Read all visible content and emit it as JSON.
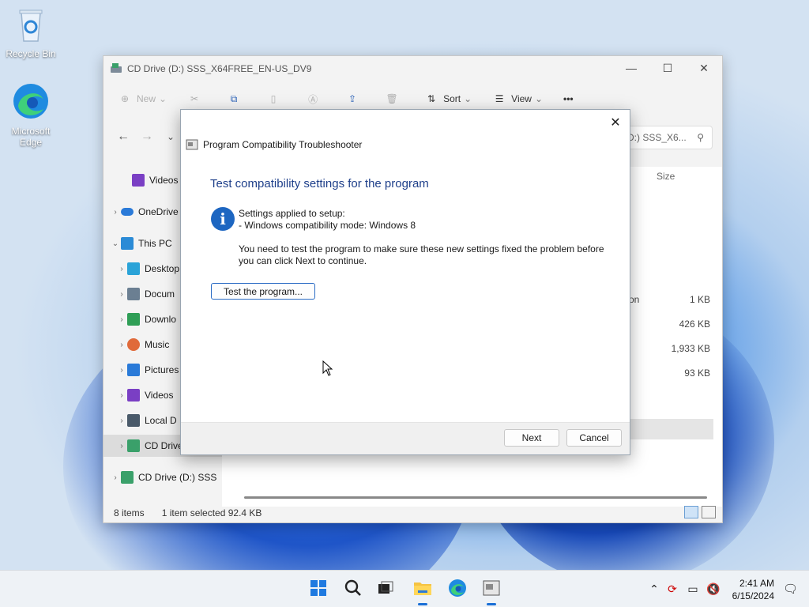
{
  "desktop": {
    "icons": [
      {
        "label": "Recycle Bin",
        "icon": "recycle-bin-icon"
      },
      {
        "label": "Microsoft Edge",
        "icon": "edge-icon"
      }
    ]
  },
  "explorer": {
    "title": "CD Drive (D:) SSS_X64FREE_EN-US_DV9",
    "toolbar": {
      "new_label": "New",
      "sort_label": "Sort",
      "view_label": "View",
      "more_label": "•••"
    },
    "search_placeholder": "D:) SSS_X6...",
    "column_size": "Size",
    "nav": [
      {
        "label": "Videos",
        "color": "#7a3fc4"
      },
      {
        "label": "OneDrive",
        "color": "#2a7ad8"
      },
      {
        "label": "This PC",
        "color": "#2b8bd6"
      },
      {
        "label": "Desktop",
        "color": "#2aa3d8"
      },
      {
        "label": "Docum",
        "color": "#6b7f92"
      },
      {
        "label": "Downlo",
        "color": "#2f9e56"
      },
      {
        "label": "Music",
        "color": "#e06a3a"
      },
      {
        "label": "Pictures",
        "color": "#2a7ad8"
      },
      {
        "label": "Videos",
        "color": "#7a3fc4"
      },
      {
        "label": "Local D",
        "color": "#4a5a6a"
      },
      {
        "label": "CD Drive",
        "color": "#3aa06a"
      },
      {
        "label": "CD Drive (D:) SSS",
        "color": "#3aa06a"
      }
    ],
    "partial_type_text": "on",
    "sizes": [
      "1 KB",
      "426 KB",
      "1,933 KB",
      "93 KB"
    ],
    "status": {
      "items": "8 items",
      "selected": "1 item selected  92.4 KB"
    }
  },
  "dialog": {
    "title": "Program Compatibility Troubleshooter",
    "heading": "Test compatibility settings for the program",
    "settings_line1": "Settings applied to setup:",
    "settings_line2": "- Windows compatibility mode: Windows 8",
    "instructions_line1": "You need to test the program to make sure these new settings fixed the problem before",
    "instructions_line2": "you can click Next to continue.",
    "test_button": "Test the program...",
    "next_button": "Next",
    "cancel_button": "Cancel"
  },
  "taskbar": {
    "apps": [
      "start-icon",
      "search-icon",
      "task-view-icon",
      "file-explorer-icon",
      "edge-icon",
      "troubleshooter-icon"
    ],
    "time": "2:41 AM",
    "date": "6/15/2024"
  }
}
